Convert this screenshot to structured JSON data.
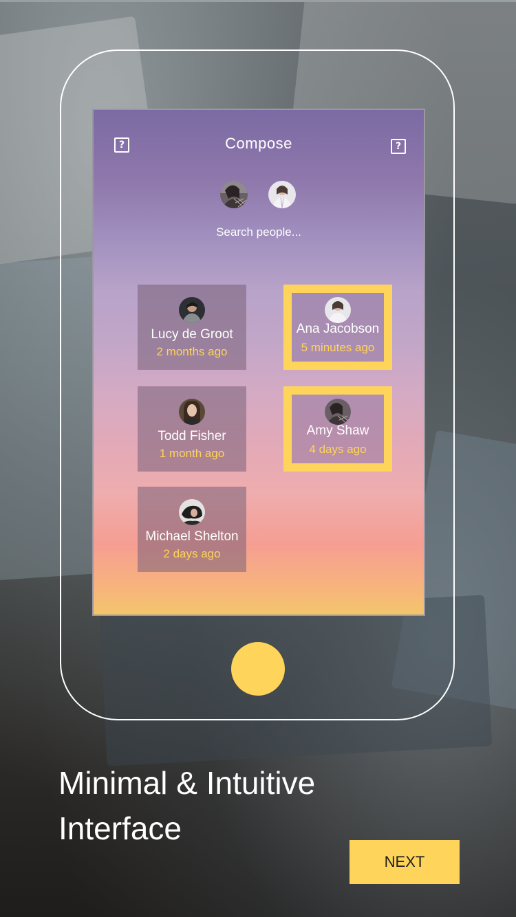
{
  "screen": {
    "title": "Compose",
    "search_placeholder": "Search people...",
    "left_icon": "help-icon",
    "right_icon": "help-icon",
    "selected_avatars": [
      "avatar-amy-shaw",
      "avatar-ana-jacobson"
    ]
  },
  "contacts": [
    {
      "name": "Lucy de Groot",
      "time": "2 months ago",
      "selected": false
    },
    {
      "name": "Ana Jacobson",
      "time": "5 minutes ago",
      "selected": true
    },
    {
      "name": "Todd Fisher",
      "time": "1 month ago",
      "selected": false
    },
    {
      "name": "Amy Shaw",
      "time": "4 days ago",
      "selected": true
    },
    {
      "name": "Michael Shelton",
      "time": "2 days ago",
      "selected": false
    }
  ],
  "headline": {
    "line1": "Minimal & Intuitive",
    "line2": "Interface"
  },
  "next_label": "NEXT",
  "colors": {
    "accent": "#ffd45a",
    "frame": "#ffffff"
  }
}
